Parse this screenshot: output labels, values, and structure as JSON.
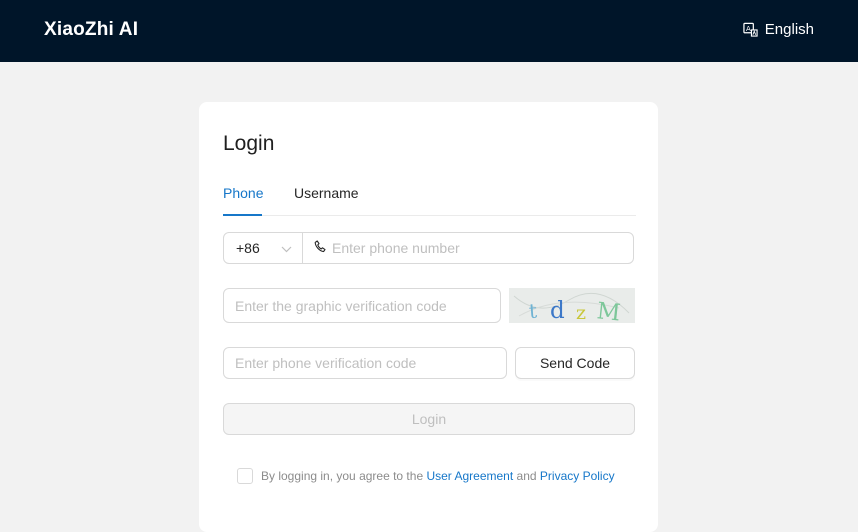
{
  "header": {
    "brand": "XiaoZhi AI",
    "language_label": "English",
    "background_color": "#001529",
    "language_icon": "translate-icon"
  },
  "login": {
    "title": "Login",
    "tabs": [
      {
        "label": "Phone",
        "active": true
      },
      {
        "label": "Username",
        "active": false
      }
    ],
    "country_code": "+86",
    "phone_placeholder": "Enter phone number",
    "captcha_placeholder": "Enter the graphic verification code",
    "captcha_text": "tdzM",
    "sms_placeholder": "Enter phone verification code",
    "send_code_label": "Send Code",
    "submit_label": "Login",
    "agreement": {
      "prefix": "By logging in, you agree to the",
      "user_agreement": "User Agreement",
      "and": "and",
      "privacy_policy": "Privacy Policy",
      "checked": false
    },
    "accent_color": "#1677c9"
  }
}
